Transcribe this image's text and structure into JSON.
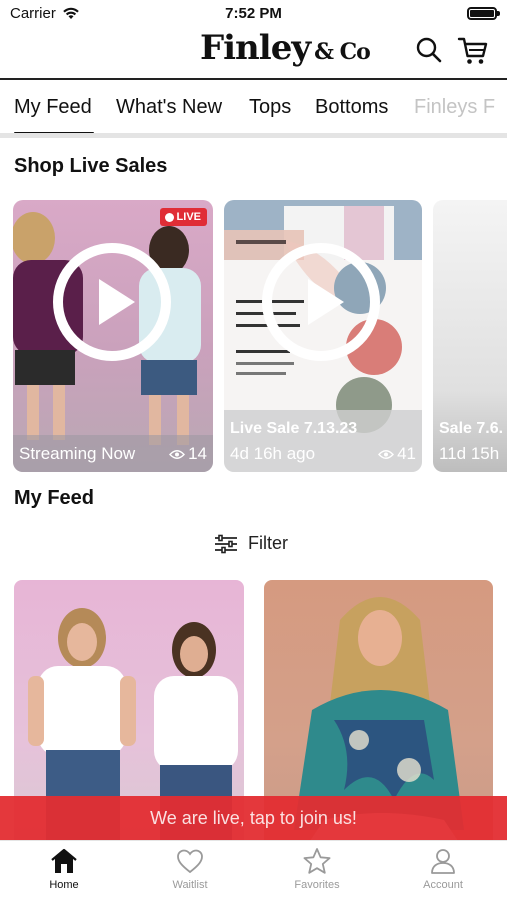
{
  "status_bar": {
    "carrier": "Carrier",
    "time": "7:52 PM",
    "battery_level": 1.0
  },
  "header": {
    "logo_main": "Finley",
    "logo_small": "& Co",
    "search_icon": "search-icon",
    "cart_icon": "cart-icon"
  },
  "tabs": [
    {
      "label": "My Feed",
      "active": true
    },
    {
      "label": "What's New"
    },
    {
      "label": "Tops"
    },
    {
      "label": "Bottoms"
    },
    {
      "label": "Finleys F"
    }
  ],
  "live_section": {
    "title": "Shop Live Sales",
    "cards": [
      {
        "badge": "LIVE",
        "status": "Streaming Now",
        "views": "14"
      },
      {
        "title": "Live Sale 7.13.23",
        "status": "4d 16h ago",
        "views": "41"
      },
      {
        "title": "Sale 7.6.",
        "status": "11d 15h"
      }
    ]
  },
  "feed": {
    "title": "My Feed",
    "filter_label": "Filter"
  },
  "live_banner": "We are live, tap to join us!",
  "bottom_nav": [
    {
      "label": "Home",
      "icon": "home-icon",
      "active": true
    },
    {
      "label": "Waitlist",
      "icon": "heart-icon"
    },
    {
      "label": "Favorites",
      "icon": "star-icon"
    },
    {
      "label": "Account",
      "icon": "account-icon"
    }
  ],
  "colors": {
    "live_red": "#e02d36",
    "banner_red": "#e32d32",
    "text_dark": "#111111",
    "nav_inactive": "#9a9a9a"
  }
}
